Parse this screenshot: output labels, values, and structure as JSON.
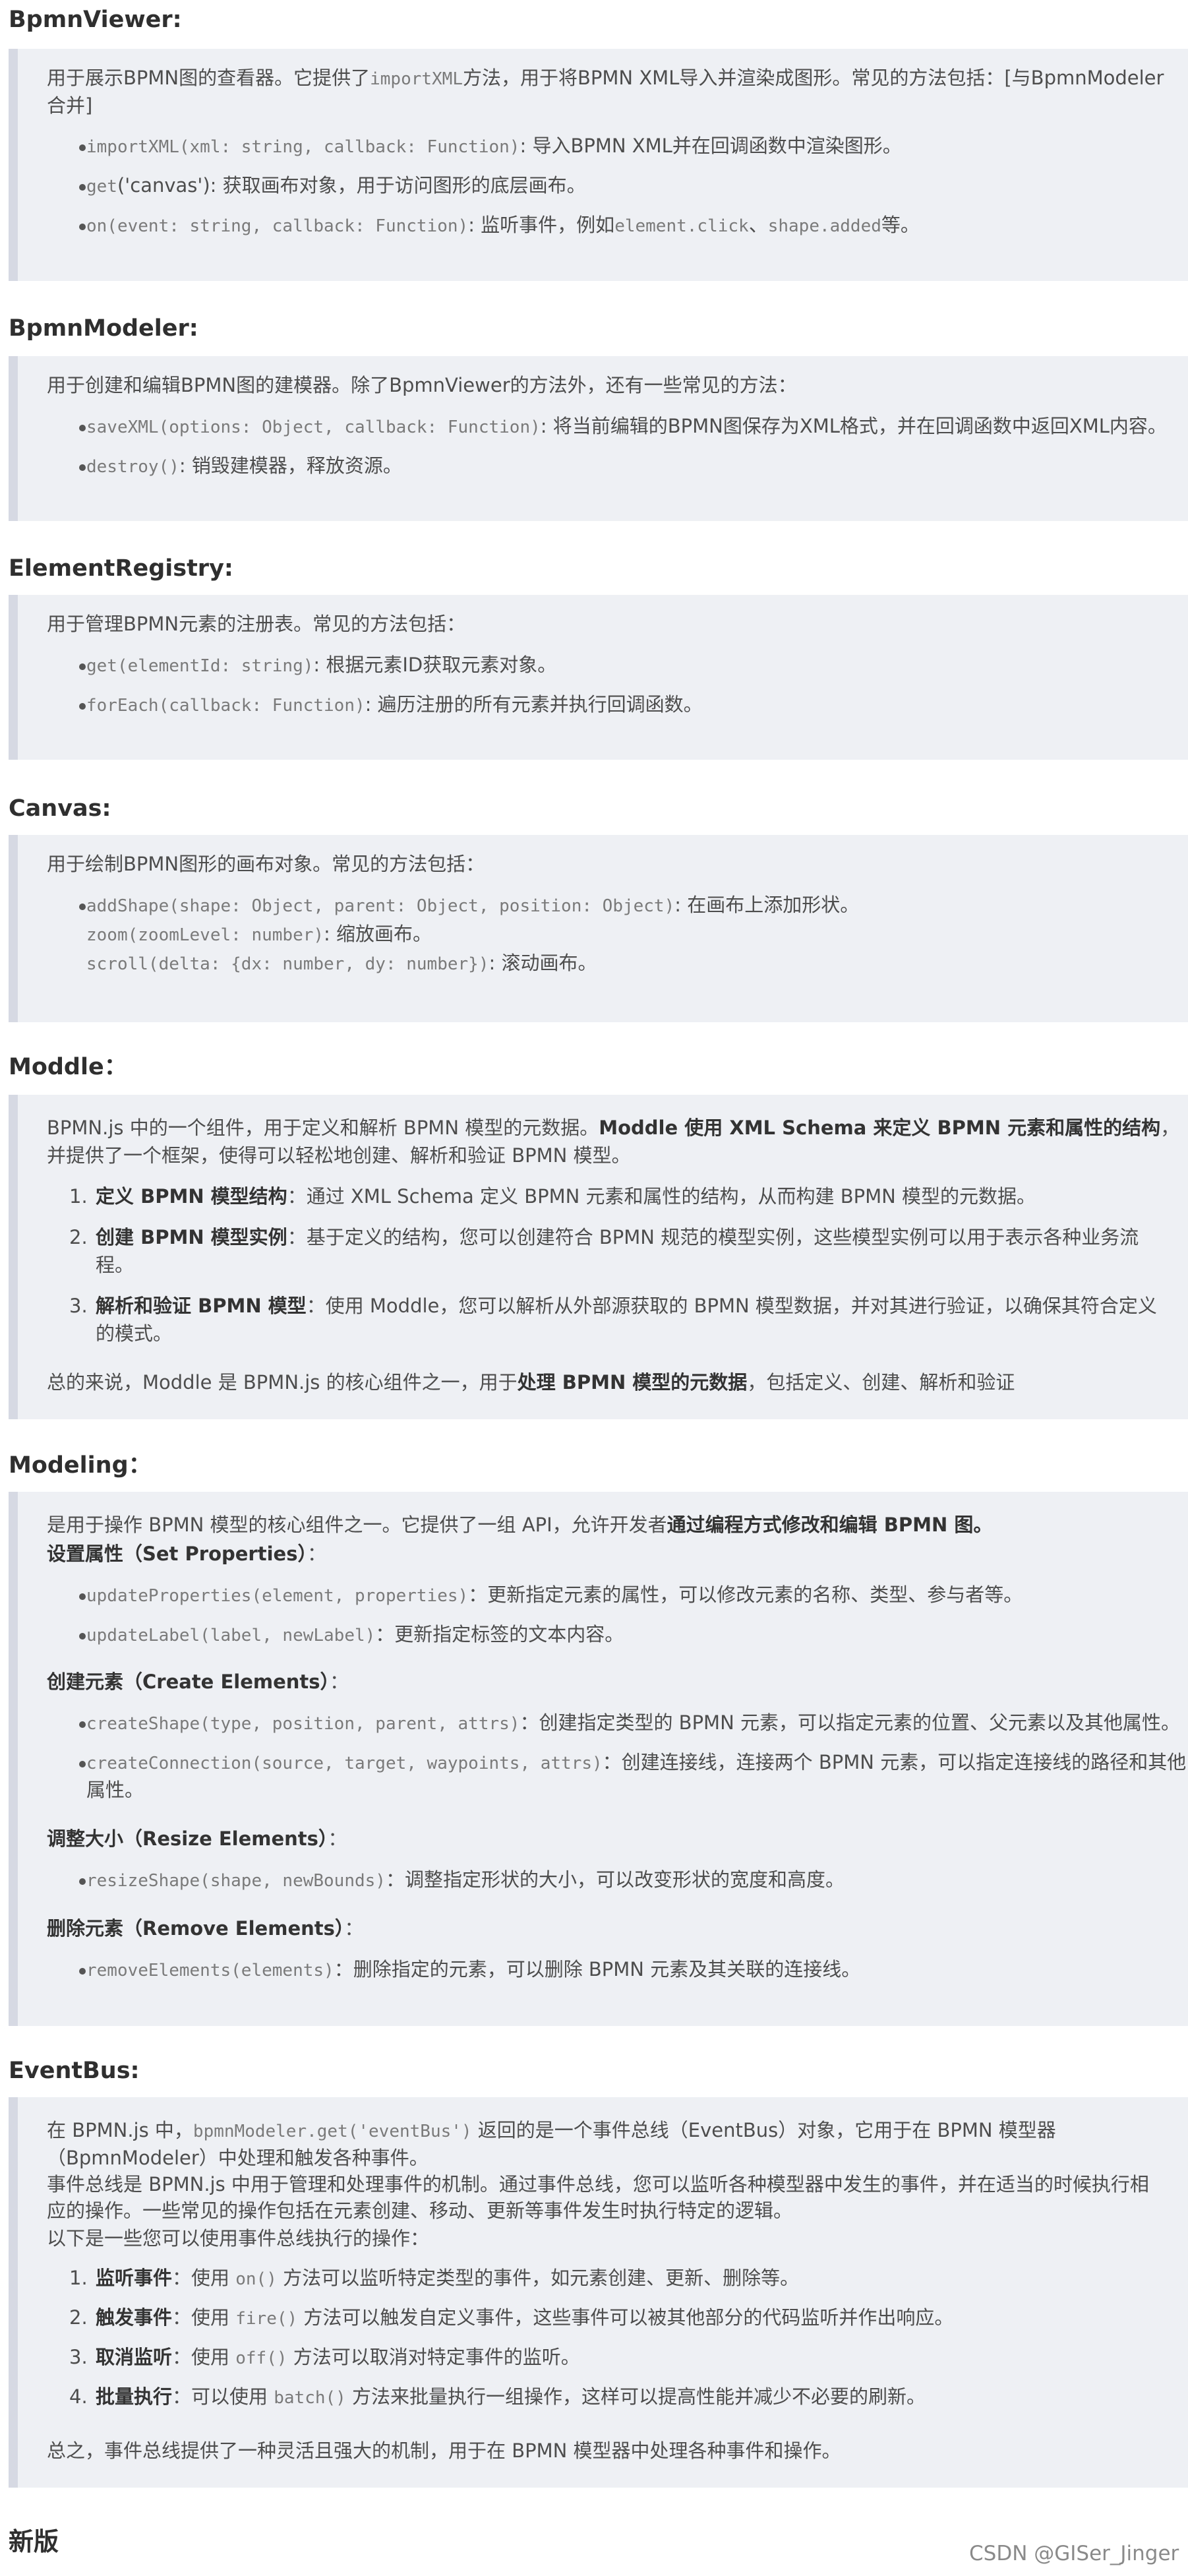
{
  "sections": {
    "viewer": {
      "title": "BpmnViewer:",
      "desc_a": "用于展示BPMN图的查看器。它提供了",
      "desc_code": "importXML",
      "desc_b": "方法，用于将BPMN XML导入并渲染成图形。常见的方法包括：[与BpmnModeler",
      "desc_c": "合并]",
      "m1_code": "importXML(xml: string, callback: Function)",
      "m1_text": ": 导入BPMN XML并在回调函数中渲染图形。",
      "m2_code": "get",
      "m2_text": "('canvas'): 获取画布对象，用于访问图形的底层画布。",
      "m3_code": "on(event: string, callback: Function)",
      "m3_text_a": ": 监听事件，例如",
      "m3_code_b": "element.click",
      "m3_sep": "、",
      "m3_code_c": "shape.added",
      "m3_text_b": "等。"
    },
    "modeler": {
      "title": "BpmnModeler:",
      "desc": "用于创建和编辑BPMN图的建模器。除了BpmnViewer的方法外，还有一些常见的方法：",
      "m1_code": "saveXML(options: Object, callback: Function)",
      "m1_text": ": 将当前编辑的BPMN图保存为XML格式，并在回调函数中返回XML内容。",
      "m2_code": "destroy()",
      "m2_text": ": 销毁建模器，释放资源。"
    },
    "registry": {
      "title": "ElementRegistry:",
      "desc": "用于管理BPMN元素的注册表。常见的方法包括：",
      "m1_code": "get(elementId: string)",
      "m1_text": ": 根据元素ID获取元素对象。",
      "m2_code": "forEach(callback: Function)",
      "m2_text": ": 遍历注册的所有元素并执行回调函数。"
    },
    "canvas": {
      "title": "Canvas:",
      "desc": "用于绘制BPMN图形的画布对象。常见的方法包括：",
      "m1_code": "addShape(shape: Object, parent: Object, position: Object)",
      "m1_text": ": 在画布上添加形状。",
      "m2_code": "zoom(zoomLevel: number)",
      "m2_text": ": 缩放画布。",
      "m3_code": "scroll(delta: {dx: number, dy: number})",
      "m3_text": ": 滚动画布。"
    },
    "moddle": {
      "title": "Moddle：",
      "p1_a": "BPMN.js 中的一个组件，用于定义和解析 BPMN 模型的元数据。",
      "p1_b": "Moddle 使用 XML Schema 来定义 BPMN 元素和属性的结构",
      "p1_c": "，",
      "p1_d": "并提供了一个框架，使得可以轻松地创建、解析和验证 BPMN 模型。",
      "i1_num": "1.",
      "i1_b": "定义 BPMN 模型结构",
      "i1_t": "：通过 XML Schema 定义 BPMN 元素和属性的结构，从而构建 BPMN 模型的元数据。",
      "i2_num": "2.",
      "i2_b": "创建 BPMN 模型实例",
      "i2_t": "：基于定义的结构，您可以创建符合 BPMN 规范的模型实例，这些模型实例可以用于表示各种业务流",
      "i2_t2": "程。",
      "i3_num": "3.",
      "i3_b": "解析和验证 BPMN 模型",
      "i3_t": "：使用 Moddle，您可以解析从外部源获取的 BPMN 模型数据，并对其进行验证，以确保其符合定义",
      "i3_t2": "的模式。",
      "sum_a": "总的来说，Moddle 是 BPMN.js 的核心组件之一，用于",
      "sum_b": "处理 BPMN 模型的元数据",
      "sum_c": "，包括定义、创建、解析和验证"
    },
    "modeling": {
      "title": "Modeling：",
      "intro_a": "是用于操作 BPMN 模型的核心组件之一。它提供了一组 API，允许开发者",
      "intro_b": "通过编程方式修改和编辑 BPMN 图。",
      "h_set": "设置属性（Set Properties）",
      "h_set_c": "：",
      "s1_code": "updateProperties(element, properties)",
      "s1_text": "：更新指定元素的属性，可以修改元素的名称、类型、参与者等。",
      "s2_code": "updateLabel(label, newLabel)",
      "s2_text": "：更新指定标签的文本内容。",
      "h_create": "创建元素（Create Elements）",
      "h_create_c": "：",
      "c1_code": "createShape(type, position, parent, attrs)",
      "c1_text": "：创建指定类型的 BPMN 元素，可以指定元素的位置、父元素以及其他属性。",
      "c2_code": "createConnection(source, target, waypoints, attrs)",
      "c2_text": "：创建连接线，连接两个 BPMN 元素，可以指定连接线的路径和其他",
      "c2_text2": "属性。",
      "h_resize": "调整大小（Resize Elements）",
      "h_resize_c": "：",
      "r1_code": "resizeShape(shape, newBounds)",
      "r1_text": "：调整指定形状的大小，可以改变形状的宽度和高度。",
      "h_remove": "删除元素（Remove Elements）",
      "h_remove_c": "：",
      "d1_code": "removeElements(elements)",
      "d1_text": "：删除指定的元素，可以删除 BPMN 元素及其关联的连接线。"
    },
    "eventbus": {
      "title": "EventBus:",
      "p1_a": "在 BPMN.js 中，",
      "p1_code": "bpmnModeler.get('eventBus')",
      "p1_b": " 返回的是一个事件总线（EventBus）对象，它用于在 BPMN 模型器",
      "p1_c": "（BpmnModeler）中处理和触发各种事件。",
      "p2_a": "事件总线是 BPMN.js 中用于管理和处理事件的机制。通过事件总线，您可以监听各种模型器中发生的事件，并在适当的时候执行相",
      "p2_b": "应的操作。一些常见的操作包括在元素创建、移动、更新等事件发生时执行特定的逻辑。",
      "p3": "以下是一些您可以使用事件总线执行的操作：",
      "i1_num": "1.",
      "i1_b": "监听事件",
      "i1_a": "：使用 ",
      "i1_code": "on()",
      "i1_t": " 方法可以监听特定类型的事件，如元素创建、更新、删除等。",
      "i2_num": "2.",
      "i2_b": "触发事件",
      "i2_a": "：使用 ",
      "i2_code": "fire()",
      "i2_t": " 方法可以触发自定义事件，这些事件可以被其他部分的代码监听并作出响应。",
      "i3_num": "3.",
      "i3_b": "取消监听",
      "i3_a": "：使用 ",
      "i3_code": "off()",
      "i3_t": " 方法可以取消对特定事件的监听。",
      "i4_num": "4.",
      "i4_b": "批量执行",
      "i4_a": "：可以使用 ",
      "i4_code": "batch()",
      "i4_t": " 方法来批量执行一组操作，这样可以提高性能并减少不必要的刷新。",
      "sum": "总之，事件总线提供了一种灵活且强大的机制，用于在 BPMN 模型器中处理各种事件和操作。"
    },
    "newver": {
      "title": "新版"
    }
  },
  "watermark": "CSDN @GISer_Jinger"
}
